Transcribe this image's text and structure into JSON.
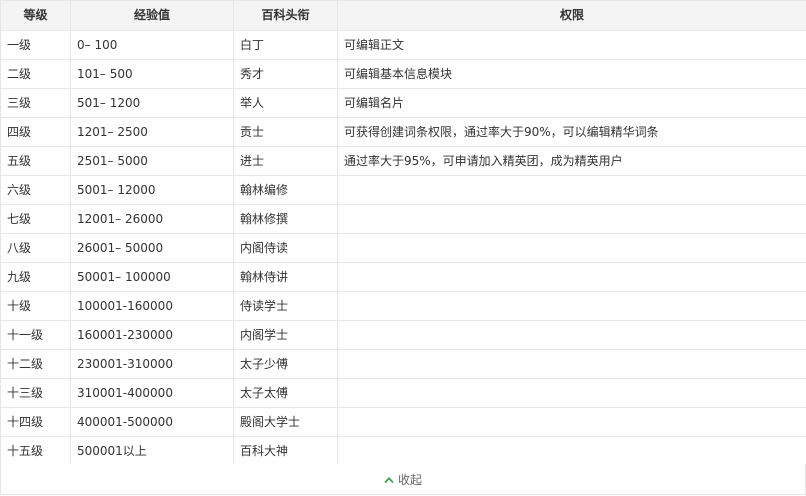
{
  "table": {
    "headers": {
      "level": "等级",
      "exp": "经验值",
      "title": "百科头衔",
      "perm": "权限"
    },
    "rows": [
      {
        "level": "一级",
        "exp": "0– 100",
        "title": "白丁",
        "perm": "可编辑正文"
      },
      {
        "level": "二级",
        "exp": "101– 500",
        "title": "秀才",
        "perm": "可编辑基本信息模块"
      },
      {
        "level": "三级",
        "exp": "501– 1200",
        "title": "举人",
        "perm": "可编辑名片"
      },
      {
        "level": "四级",
        "exp": "1201– 2500",
        "title": "贡士",
        "perm": "可获得创建词条权限，通过率大于90%，可以编辑精华词条"
      },
      {
        "level": "五级",
        "exp": "2501– 5000",
        "title": "进士",
        "perm": "通过率大于95%，可申请加入精英团，成为精英用户"
      },
      {
        "level": "六级",
        "exp": "5001– 12000",
        "title": "翰林编修",
        "perm": ""
      },
      {
        "level": "七级",
        "exp": "12001– 26000",
        "title": "翰林修撰",
        "perm": ""
      },
      {
        "level": "八级",
        "exp": "26001– 50000",
        "title": "内阁侍读",
        "perm": ""
      },
      {
        "level": "九级",
        "exp": "50001– 100000",
        "title": "翰林侍讲",
        "perm": ""
      },
      {
        "level": "十级",
        "exp": "100001-160000",
        "title": "侍读学士",
        "perm": ""
      },
      {
        "level": "十一级",
        "exp": "160001-230000",
        "title": "内阁学士",
        "perm": ""
      },
      {
        "level": "十二级",
        "exp": "230001-310000",
        "title": "太子少傅",
        "perm": ""
      },
      {
        "level": "十三级",
        "exp": "310001-400000",
        "title": "太子太傅",
        "perm": ""
      },
      {
        "level": "十四级",
        "exp": "400001-500000",
        "title": "殿阁大学士",
        "perm": ""
      },
      {
        "level": "十五级",
        "exp": "500001以上",
        "title": "百科大神",
        "perm": ""
      }
    ]
  },
  "collapse": {
    "label": "收起",
    "icon": "chevron-up-icon",
    "icon_color": "#3aa54a"
  }
}
